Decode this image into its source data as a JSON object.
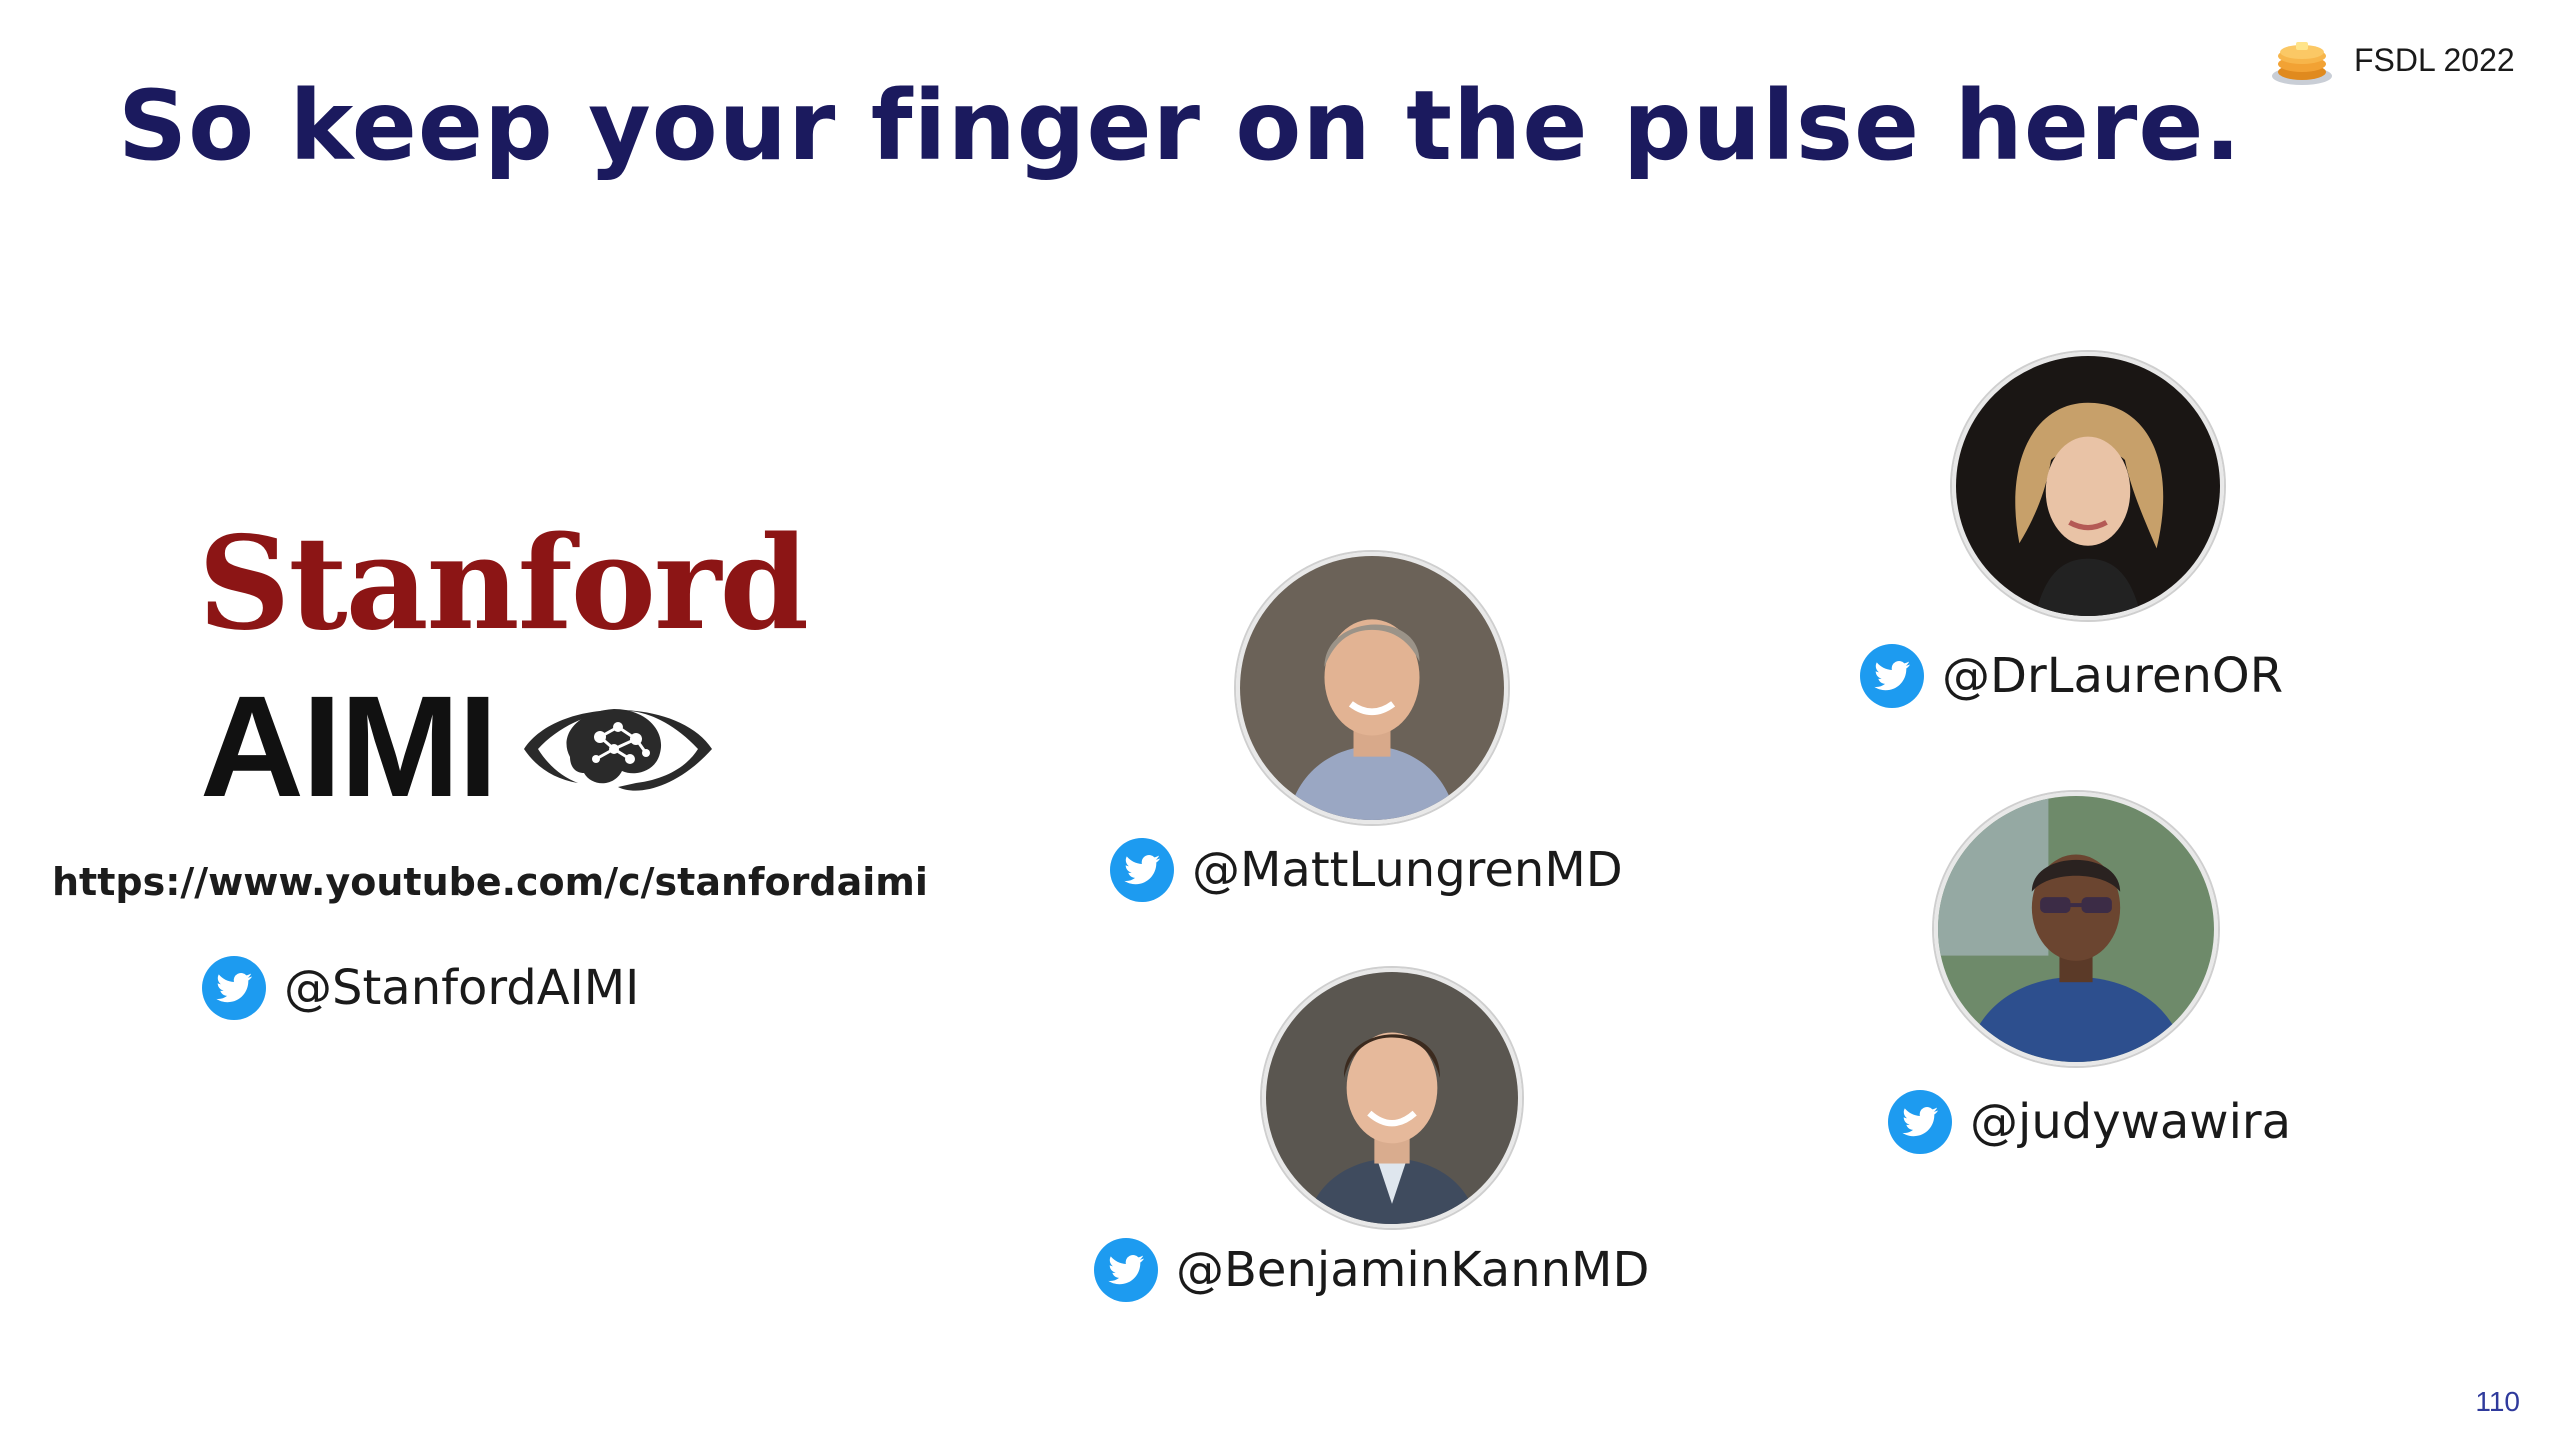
{
  "slide": {
    "title": "So keep your finger on the pulse here.",
    "badge_text": "FSDL 2022",
    "page_number": "110"
  },
  "logo": {
    "line1": "Stanford",
    "line2": "AIMI",
    "icon": "eye-brain-icon"
  },
  "url": "https://www.youtube.com/c/stanfordaimi",
  "handles": {
    "stanford": "@StanfordAIMI",
    "matt": "@MattLungrenMD",
    "benjamin": "@BenjaminKannMD",
    "lauren": "@DrLaurenOR",
    "judy": "@judywawira"
  },
  "colors": {
    "title": "#1b1a5e",
    "stanford_red": "#8c1515",
    "twitter_blue": "#1d9bf0"
  }
}
